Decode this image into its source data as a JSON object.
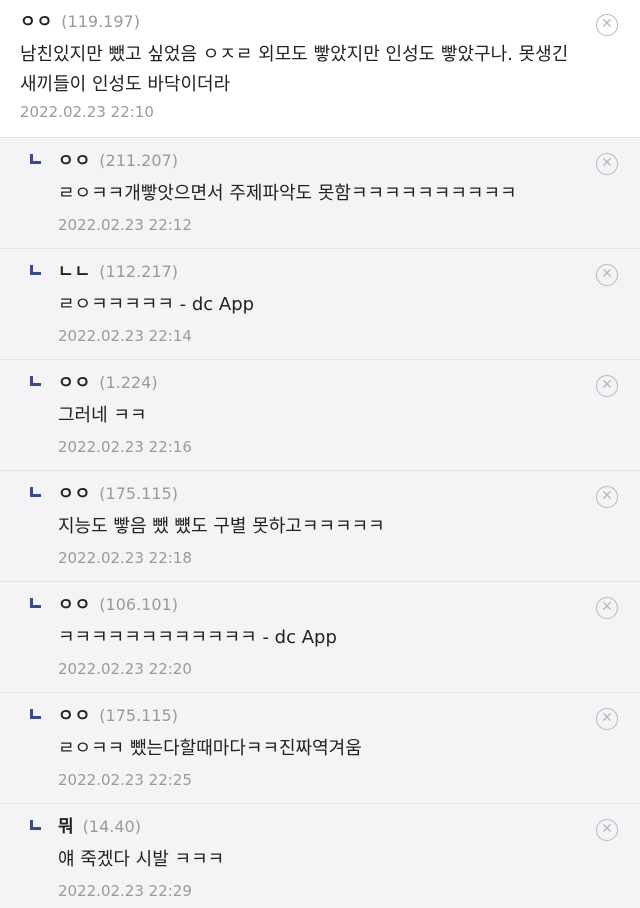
{
  "comments": [
    {
      "nick": "ㅇㅇ",
      "ip": "(119.197)",
      "text": "남친있지만 뺐고 싶었음 ㅇㅈㄹ 외모도 빻았지만 인성도 빻았구나. 못생긴 새끼들이 인성도 바닥이더라",
      "time": "2022.02.23 22:10"
    }
  ],
  "replies": [
    {
      "nick": "ㅇㅇ",
      "ip": "(211.207)",
      "text": "ㄹㅇㅋㅋ개빻앗으면서 주제파악도 못함ㅋㅋㅋㅋㅋㅋㅋㅋㅋㅋ",
      "time": "2022.02.23 22:12"
    },
    {
      "nick": "ㄴㄴ",
      "ip": "(112.217)",
      "text": "ㄹㅇㅋㅋㅋㅋㅋ - dc App",
      "time": "2022.02.23 22:14"
    },
    {
      "nick": "ㅇㅇ",
      "ip": "(1.224)",
      "text": "그러네 ㅋㅋ",
      "time": "2022.02.23 22:16"
    },
    {
      "nick": "ㅇㅇ",
      "ip": "(175.115)",
      "text": "지능도 빻음 뺐 뻈도 구별 못하고ㅋㅋㅋㅋㅋ",
      "time": "2022.02.23 22:18"
    },
    {
      "nick": "ㅇㅇ",
      "ip": "(106.101)",
      "text": "ㅋㅋㅋㅋㅋㅋㅋㅋㅋㅋㅋㅋ - dc App",
      "time": "2022.02.23 22:20"
    },
    {
      "nick": "ㅇㅇ",
      "ip": "(175.115)",
      "text": "ㄹㅇㅋㅋ 뺐는다할때마다ㅋㅋ진짜역겨움",
      "time": "2022.02.23 22:25"
    },
    {
      "nick": "뭐",
      "ip": "(14.40)",
      "text": "얘 죽겠다 시발 ㅋㅋㅋ",
      "time": "2022.02.23 22:29"
    }
  ],
  "icons": {
    "delete": "close-circle-icon",
    "reply_marker": "reply-corner-icon"
  },
  "colors": {
    "reply_background": "#f4f4f6",
    "reply_marker": "#3a4a86",
    "meta_text": "#9a9a9a"
  }
}
